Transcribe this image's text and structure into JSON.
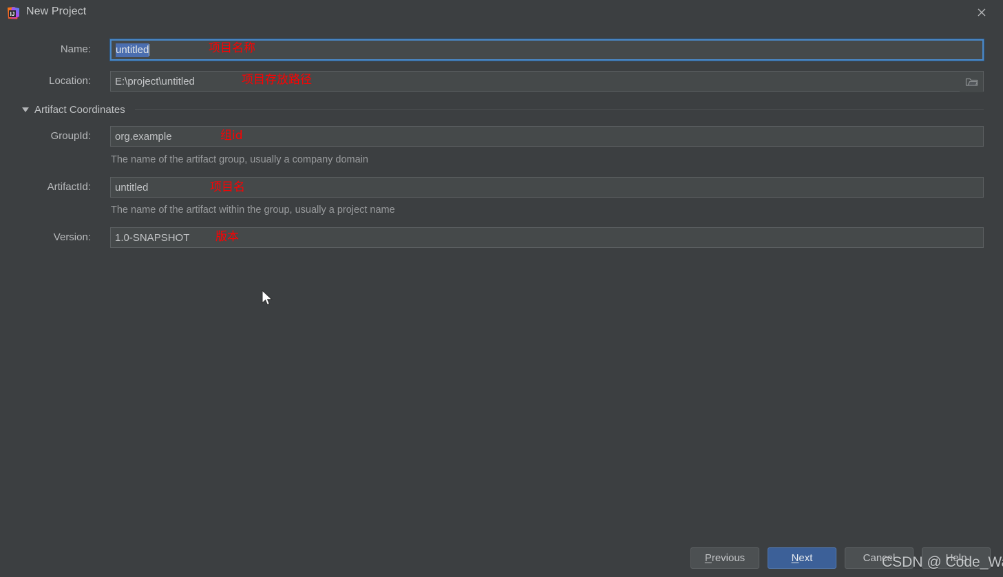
{
  "window": {
    "title": "New Project",
    "app_icon": "intellij-idea-icon",
    "close_icon": "close-icon"
  },
  "form": {
    "name": {
      "label": "Name:",
      "value": "untitled",
      "selected": true,
      "annotation": "项目名称"
    },
    "location": {
      "label": "Location:",
      "value": "E:\\project\\untitled",
      "annotation": "项目存放路径",
      "browse_icon": "folder-icon"
    },
    "group": {
      "title": "Artifact Coordinates",
      "expanded": true,
      "toggle_icon": "chevron-down-icon"
    },
    "group_id": {
      "label": "GroupId:",
      "value": "org.example",
      "annotation": "组id",
      "hint": "The name of the artifact group, usually a company domain"
    },
    "artifact_id": {
      "label": "ArtifactId:",
      "value": "untitled",
      "annotation": "项目名",
      "hint": "The name of the artifact within the group, usually a project name"
    },
    "version": {
      "label": "Version:",
      "value": "1.0-SNAPSHOT",
      "annotation": "版本"
    }
  },
  "footer": {
    "previous": "Previous",
    "previous_mnemonic": "P",
    "next": "Next",
    "next_mnemonic": "N",
    "cancel": "Cancel",
    "help": "Help"
  },
  "watermark": "CSDN @ Code_Wang",
  "colors": {
    "background": "#3c3f41",
    "field_background": "#45494a",
    "field_border": "#5b5f61",
    "focus_border": "#4a88c7",
    "selection": "#4b6eaf",
    "primary_button": "#3c6098",
    "annotation_red": "#ff0000",
    "text": "#bbbbbb",
    "hint_text": "#9a9c9e"
  }
}
